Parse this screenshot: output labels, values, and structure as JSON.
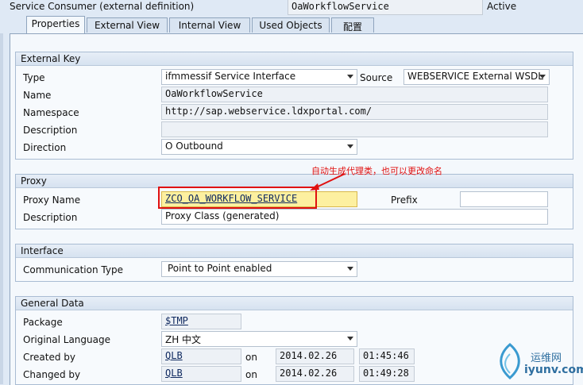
{
  "header": {
    "object_type": "Service Consumer (external definition)",
    "object_name": "OaWorkflowService",
    "status": "Active"
  },
  "tabs": [
    {
      "label": "Properties",
      "active": true
    },
    {
      "label": "External View"
    },
    {
      "label": "Internal View"
    },
    {
      "label": "Used Objects"
    },
    {
      "label": "配置"
    }
  ],
  "external_key": {
    "title": "External Key",
    "type_label": "Type",
    "type_value": "ifmmessif Service Interface",
    "source_label": "Source",
    "source_value": "WEBSERVICE External WSDL",
    "name_label": "Name",
    "name_value": "OaWorkflowService",
    "namespace_label": "Namespace",
    "namespace_value": "http://sap.webservice.ldxportal.com/",
    "description_label": "Description",
    "description_value": "",
    "direction_label": "Direction",
    "direction_value": "O Outbound"
  },
  "proxy": {
    "title": "Proxy",
    "name_label": "Proxy Name",
    "name_value": "ZCO_OA_WORKFLOW_SERVICE",
    "prefix_label": "Prefix",
    "prefix_value": "",
    "description_label": "Description",
    "description_value": "Proxy Class (generated)",
    "annotation": "自动生成代理类，也可以更改命名"
  },
  "interface": {
    "title": "Interface",
    "comm_type_label": "Communication Type",
    "comm_type_value": "Point to Point enabled"
  },
  "general_data": {
    "title": "General Data",
    "package_label": "Package",
    "package_value": "$TMP",
    "language_label": "Original Language",
    "language_value": "ZH 中文",
    "created_by_label": "Created by",
    "created_by_value": "QLB",
    "created_on_label": "on",
    "created_date": "2014.02.26",
    "created_time": "01:45:46",
    "changed_by_label": "Changed by",
    "changed_by_value": "QLB",
    "changed_on_label": "on",
    "changed_date": "2014.02.26",
    "changed_time": "01:49:28"
  },
  "watermark": {
    "line1": "运维网",
    "line2": "iyunv.com"
  },
  "colors": {
    "annotation_red": "#e01010",
    "highlight_yellow": "#fdf0a0"
  }
}
